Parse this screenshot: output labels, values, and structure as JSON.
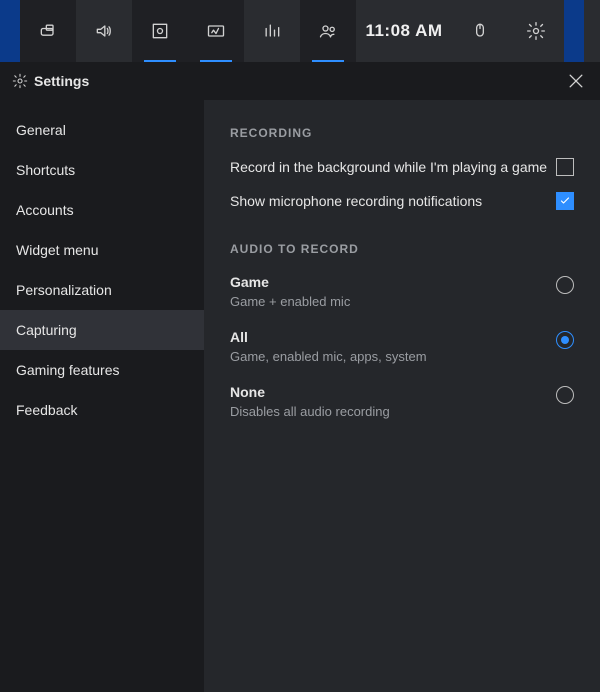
{
  "topbar": {
    "widgets": [
      {
        "name": "xbox-icon",
        "active": false
      },
      {
        "name": "audio-icon",
        "active": false
      },
      {
        "name": "capture-icon",
        "active": true
      },
      {
        "name": "performance-icon",
        "active": true
      },
      {
        "name": "resources-icon",
        "active": false
      },
      {
        "name": "social-icon",
        "active": true
      }
    ],
    "clock": "11:08 AM"
  },
  "header": {
    "title": "Settings"
  },
  "sidebar": {
    "items": [
      {
        "label": "General",
        "selected": false
      },
      {
        "label": "Shortcuts",
        "selected": false
      },
      {
        "label": "Accounts",
        "selected": false
      },
      {
        "label": "Widget menu",
        "selected": false
      },
      {
        "label": "Personalization",
        "selected": false
      },
      {
        "label": "Capturing",
        "selected": true
      },
      {
        "label": "Gaming features",
        "selected": false
      },
      {
        "label": "Feedback",
        "selected": false
      }
    ]
  },
  "content": {
    "recording": {
      "title": "RECORDING",
      "options": [
        {
          "label": "Record in the background while I'm playing a game",
          "checked": false
        },
        {
          "label": "Show microphone recording notifications",
          "checked": true
        }
      ]
    },
    "audio": {
      "title": "AUDIO TO RECORD",
      "options": [
        {
          "title": "Game",
          "desc": "Game + enabled mic",
          "selected": false
        },
        {
          "title": "All",
          "desc": "Game, enabled mic, apps, system",
          "selected": true
        },
        {
          "title": "None",
          "desc": "Disables all audio recording",
          "selected": false
        }
      ]
    }
  }
}
